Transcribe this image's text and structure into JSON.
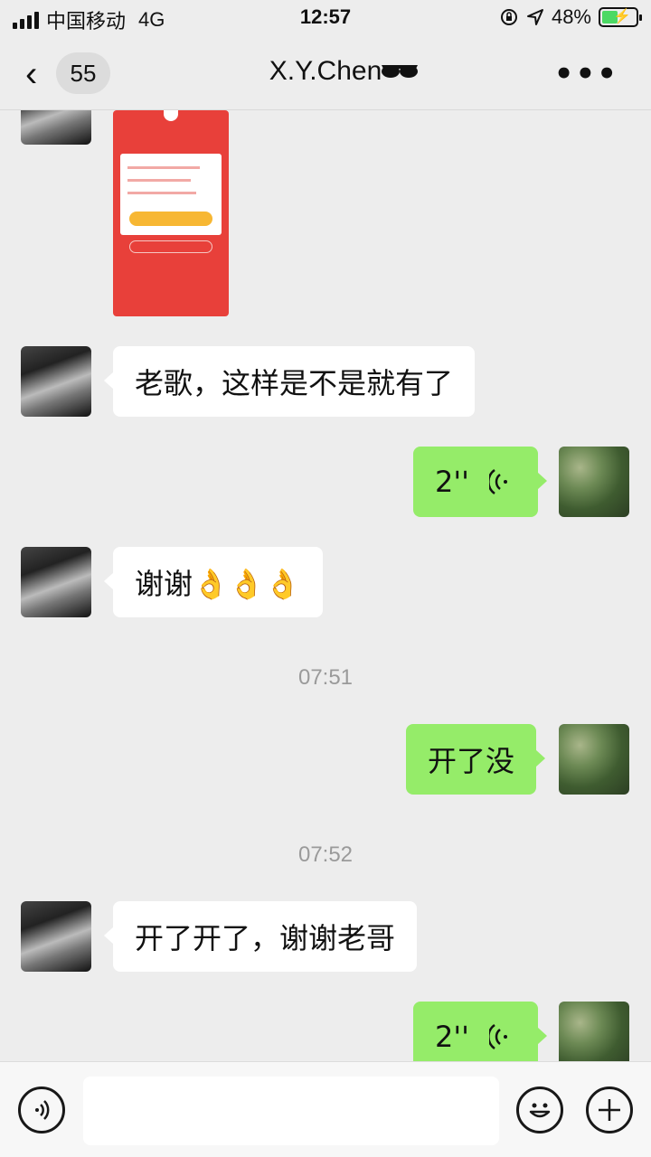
{
  "status_bar": {
    "carrier": "中国移动",
    "network": "4G",
    "time": "12:57",
    "battery_percent": "48%",
    "battery_level": 0.48
  },
  "nav": {
    "back_icon": "chevron-left-icon",
    "unread_count": "55",
    "title": "X.Y.Chen",
    "title_emoji_icon": "sunglasses-icon",
    "more_icon": "more-dots-icon"
  },
  "messages": [
    {
      "side": "in",
      "type": "image",
      "content": "poster-image"
    },
    {
      "side": "in",
      "type": "text",
      "text": "老歌，这样是不是就有了"
    },
    {
      "side": "out",
      "type": "voice",
      "duration": "2''"
    },
    {
      "side": "in",
      "type": "text",
      "text": "谢谢👌👌👌"
    },
    {
      "side": "time",
      "text": "07:51"
    },
    {
      "side": "out",
      "type": "text",
      "text": "开了没"
    },
    {
      "side": "time",
      "text": "07:52"
    },
    {
      "side": "in",
      "type": "text",
      "text": "开了开了，谢谢老哥"
    },
    {
      "side": "out",
      "type": "voice",
      "duration": "2''"
    }
  ],
  "input_bar": {
    "voice_toggle_icon": "voice-mode-icon",
    "text_value": "",
    "emoji_icon": "emoji-icon",
    "add_icon": "plus-icon"
  },
  "colors": {
    "outgoing_bubble": "#95ec69",
    "incoming_bubble": "#ffffff",
    "background": "#ededed"
  }
}
